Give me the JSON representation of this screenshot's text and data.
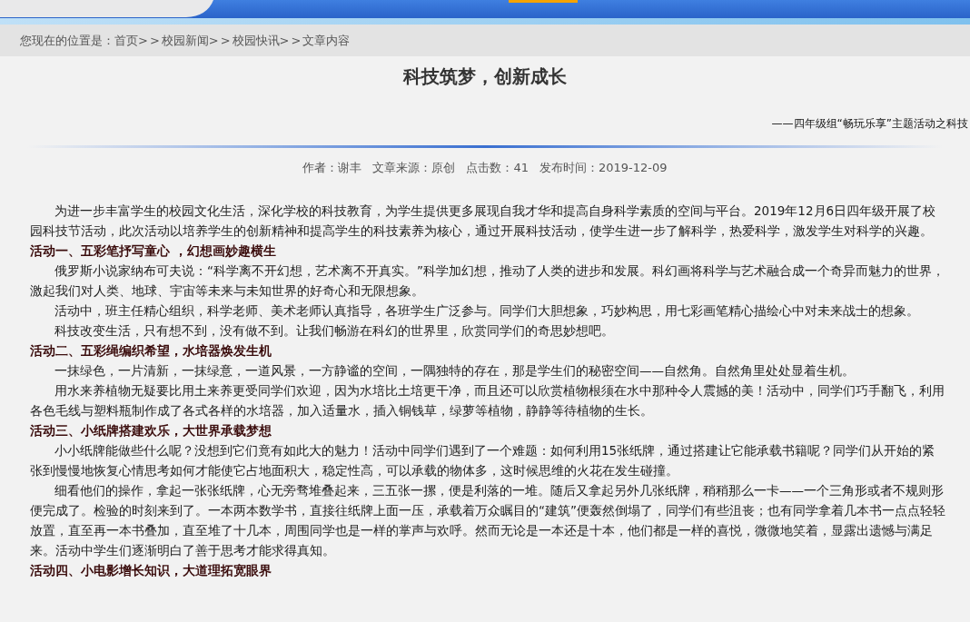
{
  "breadcrumb": {
    "label": "您现在的位置是：",
    "items": [
      {
        "kind": "link",
        "text": "首页"
      },
      {
        "kind": "separator",
        "text": ">>"
      },
      {
        "kind": "link",
        "text": "校园新闻"
      },
      {
        "kind": "separator",
        "text": ">>"
      },
      {
        "kind": "link",
        "text": "校园快讯"
      },
      {
        "kind": "separator",
        "text": ">>"
      },
      {
        "kind": "link",
        "text": "文章内容"
      }
    ]
  },
  "article": {
    "title": "科技筑梦，创新成长",
    "subtitle": "——四年级组“畅玩乐享”主题活动之科技",
    "meta": [
      "作者：谢丰",
      "文章来源：原创",
      "点击数：41",
      "发布时间：2019-12-09"
    ],
    "blocks": [
      {
        "kind": "paragraph",
        "text": "为进一步丰富学生的校园文化生活，深化学校的科技教育，为学生提供更多展现自我才华和提高自身科学素质的空间与平台。2019年12月6日四年级开展了校园科技节活动，此次活动以培养学生的创新精神和提高学生的科技素养为核心，通过开展科技活动，使学生进一步了解科学，热爱科学，激发学生对科学的兴趣。"
      },
      {
        "kind": "heading",
        "text": "活动一、五彩笔抒写童心 ，幻想画妙趣横生"
      },
      {
        "kind": "paragraph",
        "text": "俄罗斯小说家纳布可夫说：“科学离不开幻想，艺术离不开真实。”科学加幻想，推动了人类的进步和发展。科幻画将科学与艺术融合成一个奇异而魅力的世界，激起我们对人类、地球、宇宙等未来与未知世界的好奇心和无限想象。"
      },
      {
        "kind": "paragraph",
        "text": "活动中，班主任精心组织，科学老师、美术老师认真指导，各班学生广泛参与。同学们大胆想象，巧妙构思，用七彩画笔精心描绘心中对未来战士的想象。"
      },
      {
        "kind": "paragraph",
        "text": "科技改变生活，只有想不到，没有做不到。让我们畅游在科幻的世界里，欣赏同学们的奇思妙想吧。"
      },
      {
        "kind": "heading",
        "text": "活动二、五彩绳编织希望，水培器焕发生机"
      },
      {
        "kind": "paragraph",
        "text": "一抹绿色，一片清新，一抹绿意，一道风景，一方静谧的空间，一隅独特的存在，那是学生们的秘密空间——自然角。自然角里处处显着生机。"
      },
      {
        "kind": "paragraph",
        "text": "用水来养植物无疑要比用土来养更受同学们欢迎，因为水培比土培更干净，而且还可以欣赏植物根须在水中那种令人震撼的美！活动中，同学们巧手翻飞，利用各色毛线与塑料瓶制作成了各式各样的水培器，加入适量水，插入铜钱草，绿萝等植物，静静等待植物的生长。"
      },
      {
        "kind": "heading",
        "text": "活动三、小纸牌搭建欢乐，大世界承载梦想"
      },
      {
        "kind": "paragraph",
        "text": "小小纸牌能做些什么呢？没想到它们竟有如此大的魅力！活动中同学们遇到了一个难题：如何利用15张纸牌，通过搭建让它能承载书籍呢？同学们从开始的紧张到慢慢地恢复心情思考如何才能使它占地面积大，稳定性高，可以承载的物体多，这时候思维的火花在发生碰撞。"
      },
      {
        "kind": "paragraph",
        "text": "细看他们的操作，拿起一张张纸牌，心无旁骛堆叠起来，三五张一摞，便是利落的一堆。随后又拿起另外几张纸牌，稍稍那么一卡——一个三角形或者不规则形便完成了。检验的时刻来到了。一本两本数学书，直接往纸牌上面一压，承载着万众瞩目的“建筑”便轰然倒塌了，同学们有些沮丧；也有同学拿着几本书一点点轻轻放置，直至再一本书叠加，直至堆了十几本，周围同学也是一样的掌声与欢呼。然而无论是一本还是十本，他们都是一样的喜悦，微微地笑着，显露出遗憾与满足来。活动中学生们逐渐明白了善于思考才能求得真知。"
      },
      {
        "kind": "heading",
        "text": "活动四、小电影增长知识，大道理拓宽眼界"
      }
    ]
  }
}
